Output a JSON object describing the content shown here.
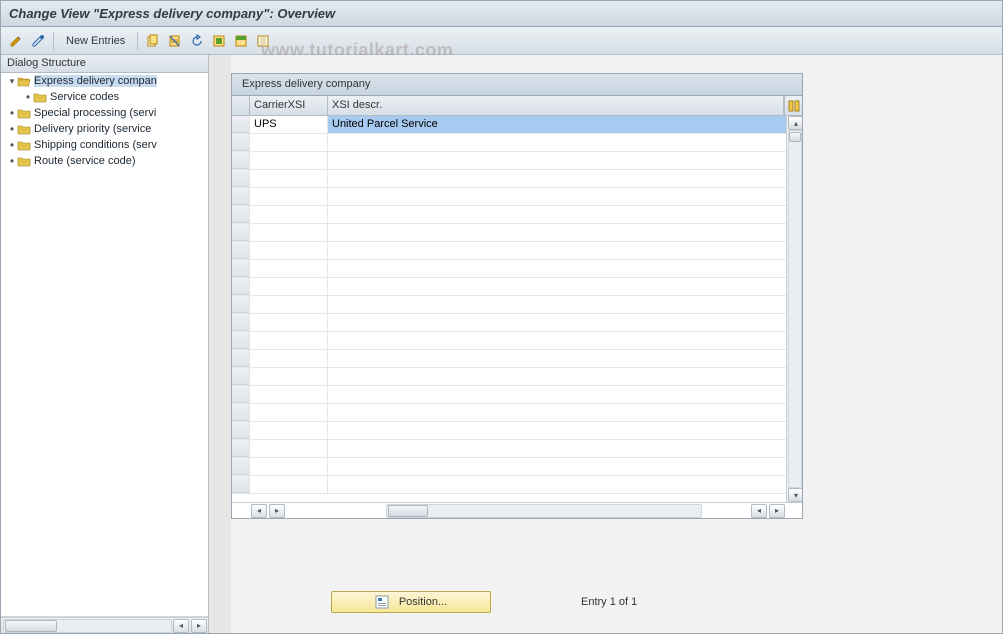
{
  "header": {
    "title": "Change View \"Express delivery company\": Overview"
  },
  "toolbar": {
    "new_entries_label": "New Entries"
  },
  "tree": {
    "header": "Dialog Structure",
    "nodes": [
      {
        "label": "Express delivery compan",
        "level": 0,
        "open": true,
        "bullet": "toggle",
        "selected": true
      },
      {
        "label": "Service codes",
        "level": 1,
        "open": false,
        "bullet": "dot",
        "selected": false
      },
      {
        "label": "Special processing (servi",
        "level": 0,
        "open": false,
        "bullet": "dot",
        "selected": false
      },
      {
        "label": "Delivery priority (service",
        "level": 0,
        "open": false,
        "bullet": "dot",
        "selected": false
      },
      {
        "label": "Shipping conditions (serv",
        "level": 0,
        "open": false,
        "bullet": "dot",
        "selected": false
      },
      {
        "label": "Route (service code)",
        "level": 0,
        "open": false,
        "bullet": "dot",
        "selected": false
      }
    ]
  },
  "grid": {
    "title": "Express delivery company",
    "columns": {
      "col1": "CarrierXSI",
      "col2": "XSI descr."
    },
    "rows": [
      {
        "carrier": "UPS",
        "descr": "United Parcel Service",
        "selected_descr": true
      }
    ]
  },
  "footer": {
    "position_label": "Position...",
    "entry_text": "Entry 1 of 1"
  },
  "watermark": "www.tutorialkart.com"
}
